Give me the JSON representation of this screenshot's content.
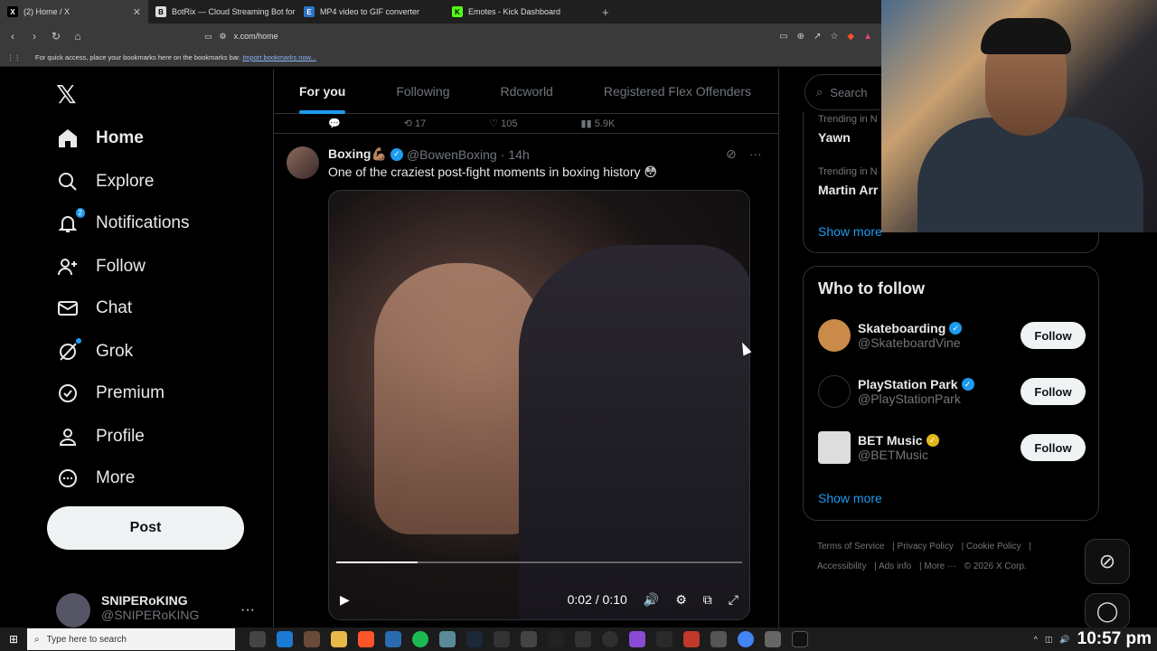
{
  "browser": {
    "tabs": [
      {
        "label": "(2) Home / X",
        "icon": "x-icon",
        "color": "#000000"
      },
      {
        "label": "BotRix — Cloud Streaming Bot for Tw",
        "icon": "botrix-icon",
        "color": "#d9d9d9"
      },
      {
        "label": "MP4 video to GIF converter",
        "icon": "ezgif-icon",
        "color": "#2a73c5"
      },
      {
        "label": "Emotes - Kick Dashboard",
        "icon": "kick-icon",
        "color": "#53fc18"
      }
    ],
    "url": "x.com/home",
    "bookmarks_hint": "For quick access, place your bookmarks here on the bookmarks bar.",
    "bookmarks_link": "Import bookmarks now..."
  },
  "nav": {
    "items": [
      {
        "label": "Home",
        "icon": "home-icon"
      },
      {
        "label": "Explore",
        "icon": "search-icon"
      },
      {
        "label": "Notifications",
        "icon": "bell-icon",
        "badge": "2"
      },
      {
        "label": "Follow",
        "icon": "person-plus-icon"
      },
      {
        "label": "Chat",
        "icon": "mail-icon"
      },
      {
        "label": "Grok",
        "icon": "grok-icon"
      },
      {
        "label": "Premium",
        "icon": "verified-badge-icon"
      },
      {
        "label": "Profile",
        "icon": "person-icon"
      },
      {
        "label": "More",
        "icon": "more-circle-icon"
      }
    ],
    "post_button": "Post",
    "profile_name": "SNIPERoKING",
    "profile_handle": "@SNIPERoKING",
    "more_glyph": "···"
  },
  "feed": {
    "tabs": [
      "For you",
      "Following",
      "Rdcworld",
      "Registered Flex Offenders"
    ],
    "prev_actions": {
      "retweets": "17",
      "likes": "105",
      "views": "5.9K"
    },
    "tweet": {
      "name": "Boxing💪🏽",
      "handle": "@BowenBoxing",
      "time": "14h",
      "text": "One of the craziest post-fight moments in boxing history 😳",
      "video_time": "0:02 / 0:10",
      "progress": 0.2
    }
  },
  "right": {
    "search_placeholder": "Search",
    "trends": [
      {
        "label": "Trending in N",
        "name": "Yawn"
      },
      {
        "label": "Trending in N",
        "name": "Martin Arr"
      }
    ],
    "show_more": "Show more",
    "who_to_follow_title": "Who to follow",
    "suggestions": [
      {
        "name": "Skateboarding",
        "handle": "@SkateboardVine",
        "badge_color": "#1d9bf0",
        "avatar_color": "#c98a4a"
      },
      {
        "name": "PlayStation Park",
        "handle": "@PlayStationPark",
        "badge_color": "#1d9bf0",
        "avatar_color": "#000000"
      },
      {
        "name": "BET Music",
        "handle": "@BETMusic",
        "badge_color": "#e2b719",
        "avatar_color": "#dddddd"
      }
    ],
    "follow_label": "Follow",
    "footer": [
      "Terms of Service",
      "Privacy Policy",
      "Cookie Policy",
      "Accessibility",
      "Ads info",
      "More ···",
      "© 2026 X Corp."
    ]
  },
  "taskbar": {
    "search_placeholder": "Type here to search",
    "clock": "10:57 pm"
  },
  "accent": "#1d9bf0"
}
